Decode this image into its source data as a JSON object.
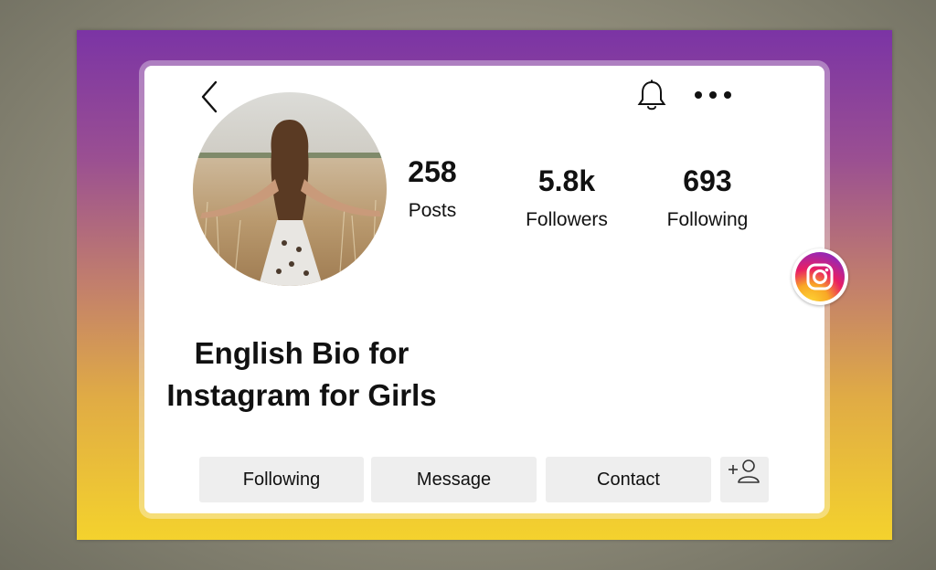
{
  "header": {
    "back_icon": "chevron-left-icon",
    "notifications_icon": "bell-icon",
    "more_icon": "more-horizontal-icon"
  },
  "profile": {
    "avatar_description": "profile-photo"
  },
  "stats": {
    "posts": {
      "value": "258",
      "label": "Posts"
    },
    "followers": {
      "value": "5.8k",
      "label": "Followers"
    },
    "following": {
      "value": "693",
      "label": "Following"
    }
  },
  "bio": {
    "line1": "English Bio for",
    "line2": "Instagram for Girls"
  },
  "actions": {
    "following_label": "Following",
    "message_label": "Message",
    "contact_label": "Contact",
    "add_user_icon": "add-user-icon"
  },
  "brand": {
    "logo": "instagram-logo"
  },
  "colors": {
    "gradient_top": "#7b34a5",
    "gradient_bottom": "#f4d22d",
    "button_bg": "#eeeeee"
  }
}
